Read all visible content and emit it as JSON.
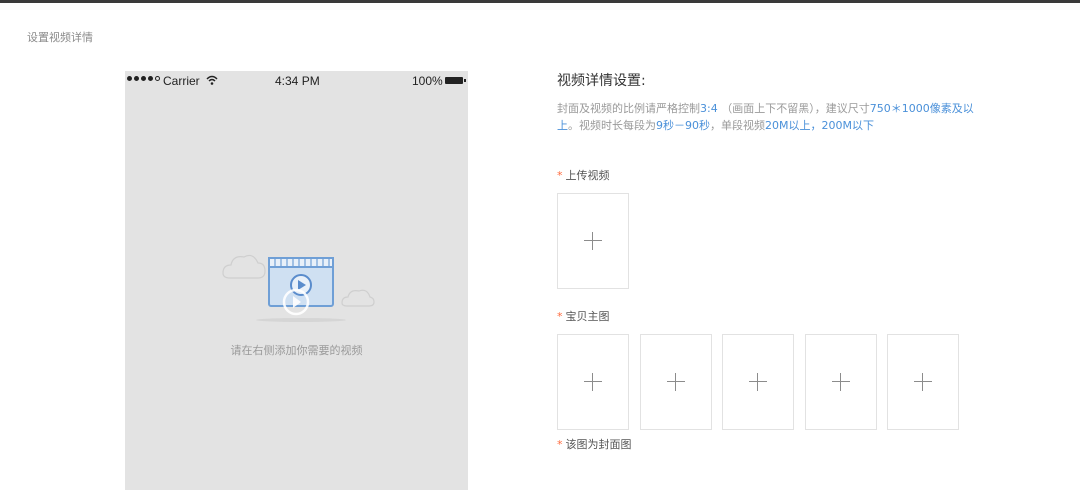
{
  "page": {
    "label": "设置视频详情"
  },
  "phone_preview": {
    "status_bar": {
      "carrier": "Carrier",
      "time": "4:34 PM",
      "battery": "100%"
    },
    "empty_text": "请在右侧添加你需要的视频",
    "icons": [
      "signal-icon",
      "wifi-icon",
      "battery-icon",
      "video-illustration-icon",
      "cloud-icon",
      "play-icon"
    ]
  },
  "settings": {
    "title": "视频详情设置:",
    "hint": {
      "p1": "封面及视频的比例请严格控制",
      "hl1": "3:4",
      "p2": " （画面上下不留黑），建议尺寸",
      "hl2": "750＊1000像素及以上",
      "p3": "。视频时长每段为",
      "hl3": "9秒－90秒",
      "p4": "，单段视频",
      "hl4": "20M以上，200M以下"
    },
    "upload_video": {
      "required_mark": "*",
      "label": "上传视频"
    },
    "main_images": {
      "required_mark": "*",
      "label": "宝贝主图",
      "slots": 5
    },
    "cover_note": {
      "required_mark": "*",
      "label": "该图为封面图"
    }
  },
  "colors": {
    "accent": "#4a90d9",
    "required": "#ff6a3d",
    "preview_bg": "#e3e3e3"
  }
}
